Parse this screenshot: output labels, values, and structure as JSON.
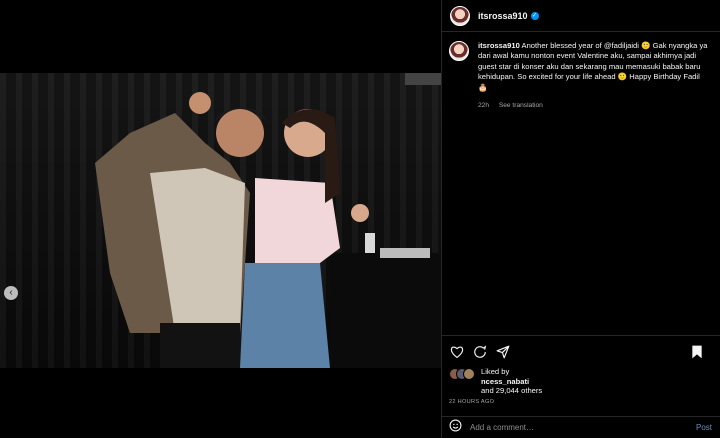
{
  "header": {
    "username": "itsrossa910"
  },
  "caption": {
    "username": "itsrossa910",
    "text": "Another blessed year of @fadiljaidi 🙂 Gak nyangka ya dari awal kamu nonton event Valentine aku, sampai akhirnya jadi guest star di konser aku dan sekarang mau memasuki babak baru kehidupan. So excited for your life ahead 🙂 Happy Birthday Fadil 🎂",
    "age": "22h",
    "see_translation": "See translation"
  },
  "likes": {
    "liked_by": "Liked by",
    "top_liker": "ncess_nabati",
    "others": "and 29,044 others"
  },
  "timestamp": "22 HOURS AGO",
  "comment": {
    "placeholder": "Add a comment…",
    "post_label": "Post"
  },
  "media": {
    "slide_count": 2,
    "active_slide": 1
  }
}
